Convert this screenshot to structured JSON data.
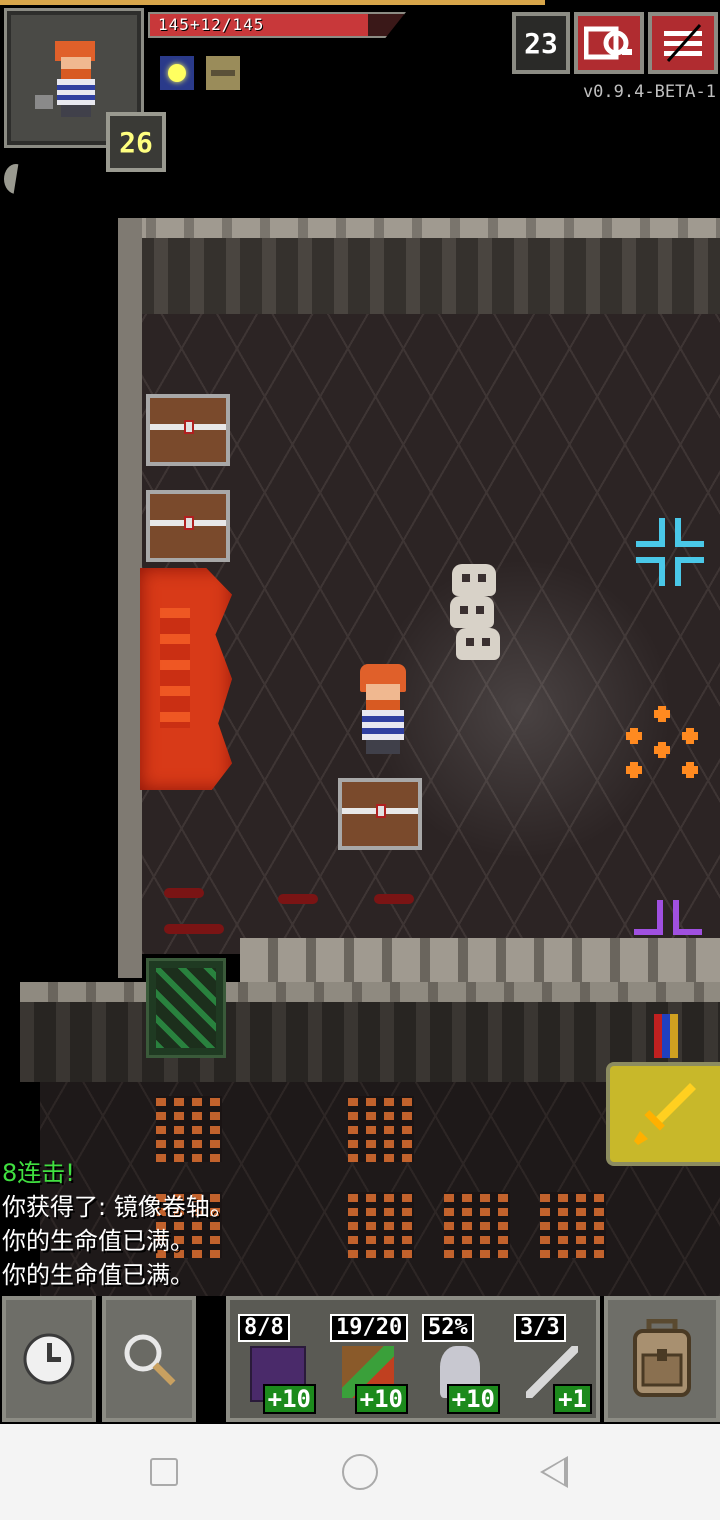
{
  "hud": {
    "hp_text": "145+12/145",
    "hp_fraction": 0.86,
    "level": "26",
    "depth": "23",
    "version": "v0.9.4-BETA-1",
    "buffs": [
      "light-buff-icon",
      "hunger-buff-icon"
    ]
  },
  "log": [
    {
      "text": "8连击!",
      "color": "#40e040"
    },
    {
      "text": "你获得了: 镜像卷轴。",
      "color": "#ffffff"
    },
    {
      "text": "你的生命值已满。",
      "color": "#ffffff"
    },
    {
      "text": "你的生命值已满。",
      "color": "#ffffff"
    }
  ],
  "quickslots": [
    {
      "top": "8/8",
      "bottom": "+10",
      "icon": "tome-icon"
    },
    {
      "top": "19/20",
      "bottom": "+10",
      "icon": "horn-of-plenty-icon"
    },
    {
      "top": "52%",
      "bottom": "+10",
      "icon": "chalice-icon"
    },
    {
      "top": "3/3",
      "bottom": "+1",
      "icon": "wand-icon"
    }
  ],
  "colors": {
    "hp": "#c8383a",
    "accent_red": "#b02c30",
    "attack_yellow": "#c8b82a",
    "log_green": "#40e040"
  }
}
